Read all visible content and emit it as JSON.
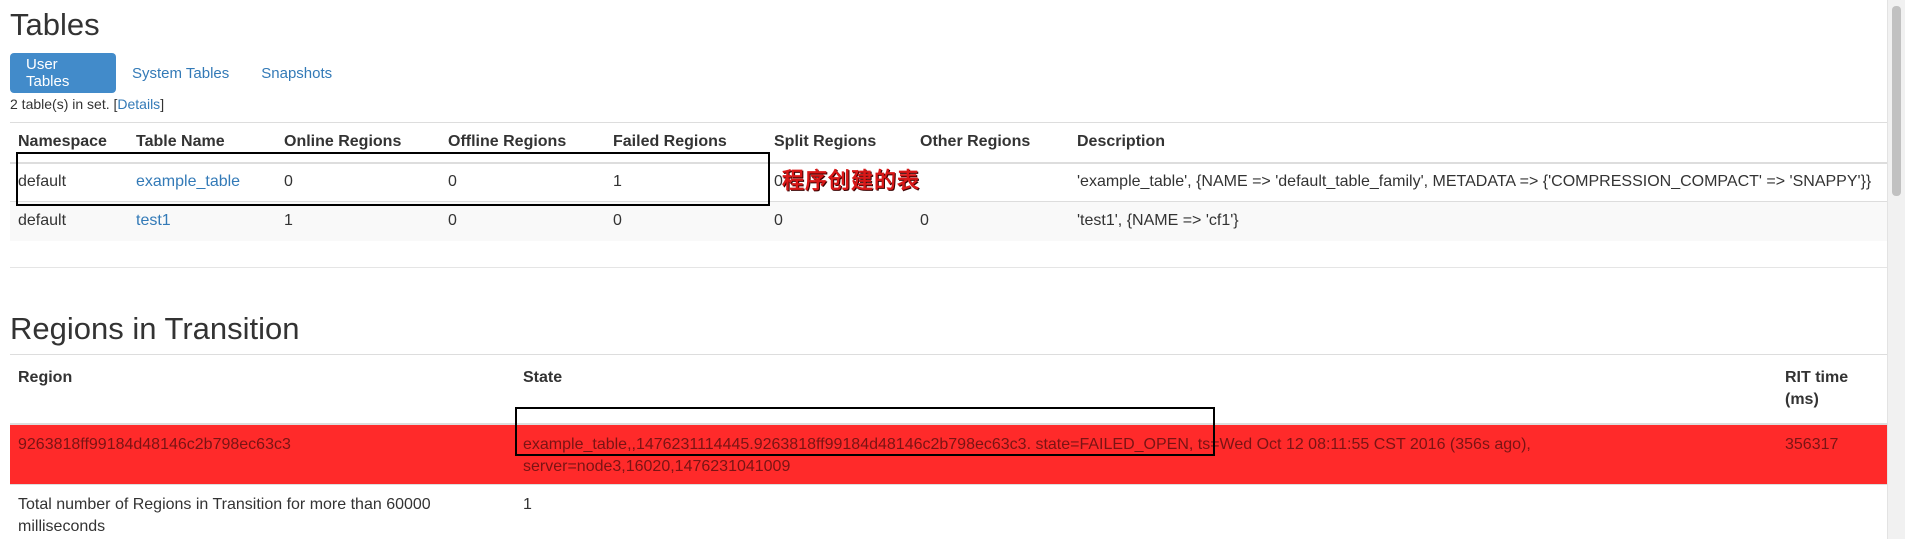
{
  "tables_section": {
    "heading": "Tables",
    "tabs": [
      {
        "label": "User Tables",
        "active": true
      },
      {
        "label": "System Tables",
        "active": false
      },
      {
        "label": "Snapshots",
        "active": false
      }
    ],
    "count_text": "2 table(s) in set. [",
    "details_link": "Details",
    "count_suffix": "]",
    "columns": [
      "Namespace",
      "Table Name",
      "Online Regions",
      "Offline Regions",
      "Failed Regions",
      "Split Regions",
      "Other Regions",
      "Description"
    ],
    "rows": [
      {
        "namespace": "default",
        "table_name": "example_table",
        "online": "0",
        "offline": "0",
        "failed": "1",
        "split": "0",
        "other": "",
        "description": "'example_table', {NAME => 'default_table_family', METADATA => {'COMPRESSION_COMPACT' => 'SNAPPY'}}"
      },
      {
        "namespace": "default",
        "table_name": "test1",
        "online": "1",
        "offline": "0",
        "failed": "0",
        "split": "0",
        "other": "0",
        "description": "'test1', {NAME => 'cf1'}"
      }
    ],
    "annotation": "程序创建的表"
  },
  "rit_section": {
    "heading": "Regions in Transition",
    "columns": [
      "Region",
      "State",
      "RIT time (ms)"
    ],
    "rows": [
      {
        "region": "9263818ff99184d48146c2b798ec63c3",
        "state": "example_table,,1476231114445.9263818ff99184d48146c2b798ec63c3. state=FAILED_OPEN, ts=Wed Oct 12 08:11:55 CST 2016 (356s ago), server=node3,16020,1476231041009",
        "rit_time": "356317"
      },
      {
        "region": "Total number of Regions in Transition for more than 60000 milliseconds",
        "state": "1",
        "rit_time": ""
      }
    ]
  },
  "colors": {
    "accent": "#428bca",
    "link": "#337ab7",
    "failed_row": "#ff2a2a",
    "annotation": "#d81818"
  }
}
